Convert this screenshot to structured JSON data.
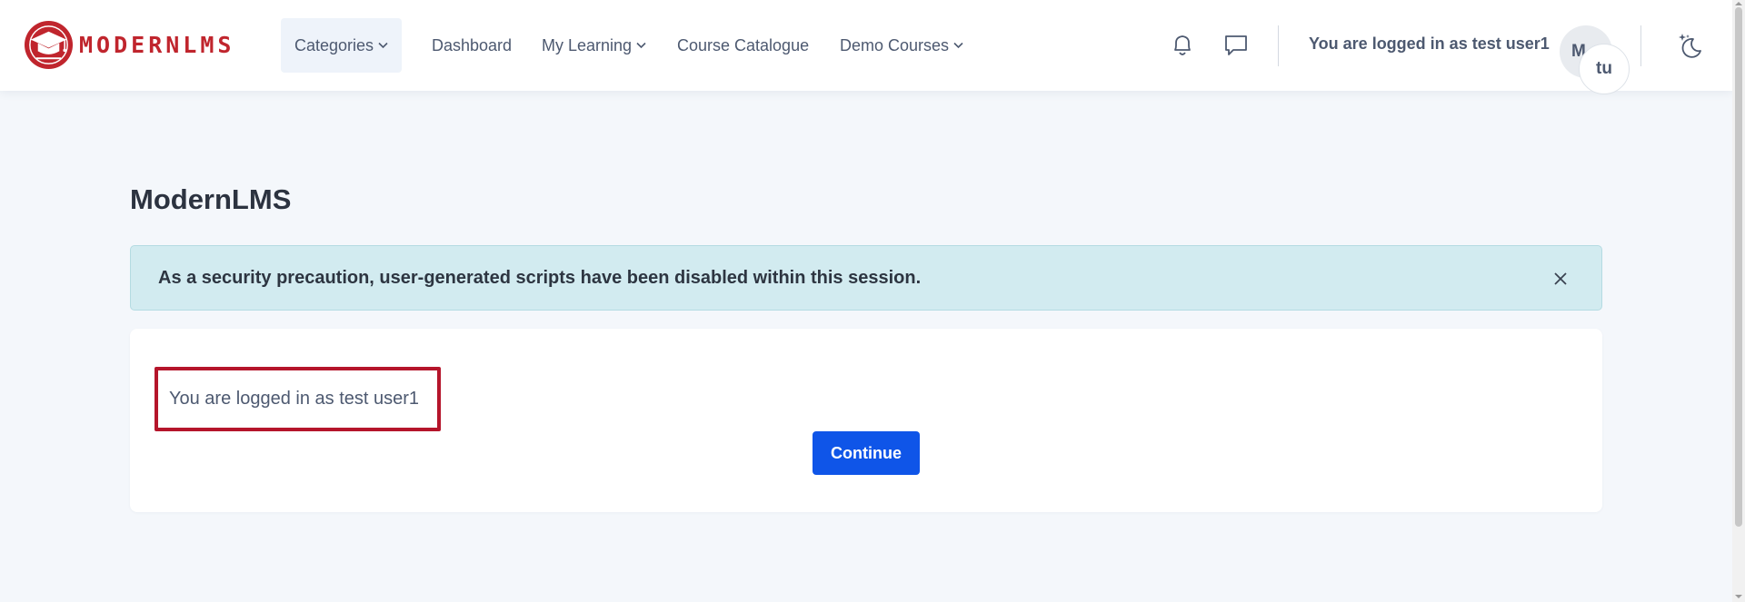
{
  "brand": {
    "name": "MODERNLMS"
  },
  "nav": {
    "items": [
      {
        "label": "Categories",
        "has_dropdown": true,
        "active": true
      },
      {
        "label": "Dashboard",
        "has_dropdown": false
      },
      {
        "label": "My Learning",
        "has_dropdown": true
      },
      {
        "label": "Course Catalogue",
        "has_dropdown": false
      },
      {
        "label": "Demo Courses",
        "has_dropdown": true
      }
    ]
  },
  "header": {
    "icons": [
      "bell-icon",
      "chat-icon",
      "dark-mode-icon"
    ],
    "user_text": "You are logged in as test user1",
    "avatar_initials": "M",
    "avatar_badge": "tu"
  },
  "page": {
    "title": "ModernLMS"
  },
  "alert": {
    "message": "As a security precaution, user-generated scripts have been disabled within this session."
  },
  "main": {
    "login_message": "You are logged in as test user1",
    "continue_label": "Continue"
  },
  "colors": {
    "brand_red": "#c0252d",
    "primary_button": "#0f55e8",
    "alert_bg": "#d2ebf0",
    "highlight_border": "#b5152b"
  }
}
